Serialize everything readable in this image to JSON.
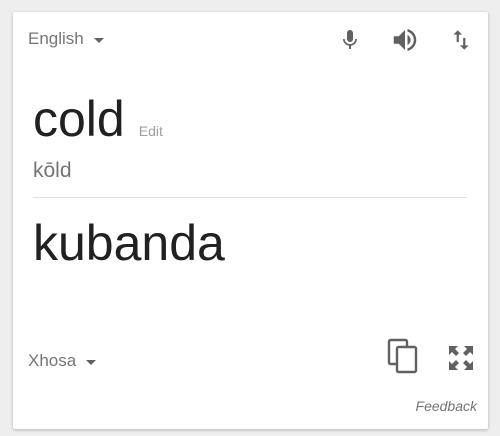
{
  "source_language": {
    "label": "English"
  },
  "target_language": {
    "label": "Xhosa"
  },
  "source": {
    "text": "cold",
    "edit_label": "Edit",
    "transliteration": "kōld"
  },
  "translation": {
    "text": "kubanda"
  },
  "footer": {
    "feedback_label": "Feedback"
  },
  "icons": {
    "toolbar": [
      "microphone-icon",
      "speaker-icon",
      "swap-languages-icon"
    ],
    "bottom": [
      "copy-icon",
      "fullscreen-icon"
    ]
  },
  "colors": {
    "icon": "#616161",
    "text_primary": "#212121",
    "text_secondary": "#757575",
    "text_muted": "#9e9e9e",
    "divider": "#e0e0e0"
  }
}
